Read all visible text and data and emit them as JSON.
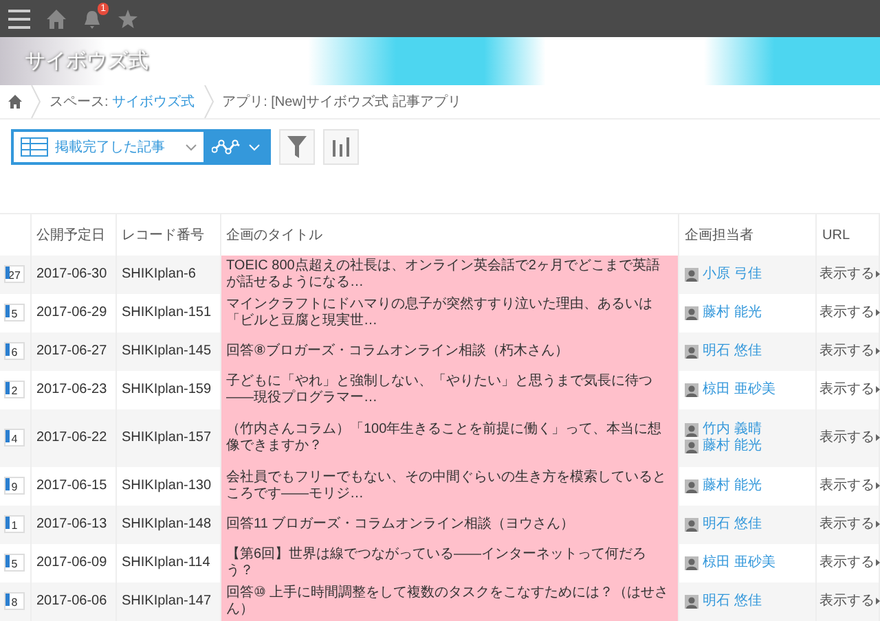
{
  "topbar": {
    "notification_badge": "1"
  },
  "banner": {
    "title": "サイボウズ式"
  },
  "breadcrumb": [
    {
      "prefix": "スペース: ",
      "link": "サイボウズ式"
    },
    {
      "prefix": "アプリ: [New]サイボウズ式 記事アプリ"
    }
  ],
  "view_select": {
    "value": "掲載完了した記事"
  },
  "table": {
    "columns": [
      "公開予定日",
      "レコード番号",
      "企画のタイトル",
      "企画担当者",
      "URL"
    ],
    "rows": [
      {
        "day": "27",
        "date": "2017-06-30",
        "record": "SHIKIplan-6",
        "title": "TOEIC 800点超えの社長は、オンライン英会話で2ヶ月でどこまで英語が話せるようになる…",
        "people": [
          "小原 弓佳"
        ],
        "url": "表示する"
      },
      {
        "day": "5",
        "date": "2017-06-29",
        "record": "SHIKIplan-151",
        "title": "マインクラフトにドハマりの息子が突然すすり泣いた理由、あるいは「ビルと豆腐と現実世…",
        "people": [
          "藤村 能光"
        ],
        "url": "表示する"
      },
      {
        "day": "6",
        "date": "2017-06-27",
        "record": "SHIKIplan-145",
        "title": "回答⑧ブロガーズ・コラムオンライン相談（朽木さん）",
        "people": [
          "明石 悠佳"
        ],
        "url": "表示する"
      },
      {
        "day": "2",
        "date": "2017-06-23",
        "record": "SHIKIplan-159",
        "title": "子どもに「やれ」と強制しない、「やりたい」と思うまで気長に待つ――現役プログラマー…",
        "people": [
          "椋田 亜砂美"
        ],
        "url": "表示する"
      },
      {
        "day": "4",
        "date": "2017-06-22",
        "record": "SHIKIplan-157",
        "title": "（竹内さんコラム）「100年生きることを前提に働く」って、本当に想像できますか？",
        "people": [
          "竹内 義晴",
          "藤村 能光"
        ],
        "url": "表示する"
      },
      {
        "day": "9",
        "date": "2017-06-15",
        "record": "SHIKIplan-130",
        "title": "会社員でもフリーでもない、その中間ぐらいの生き方を模索しているところです――モリジ…",
        "people": [
          "藤村 能光"
        ],
        "url": "表示する"
      },
      {
        "day": "1",
        "date": "2017-06-13",
        "record": "SHIKIplan-148",
        "title": "回答11 ブロガーズ・コラムオンライン相談（ヨウさん）",
        "people": [
          "明石 悠佳"
        ],
        "url": "表示する"
      },
      {
        "day": "5",
        "date": "2017-06-09",
        "record": "SHIKIplan-114",
        "title": "【第6回】世界は線でつながっている――インターネットって何だろう？",
        "people": [
          "椋田 亜砂美"
        ],
        "url": "表示する"
      },
      {
        "day": "8",
        "date": "2017-06-06",
        "record": "SHIKIplan-147",
        "title": "回答⑩ 上手に時間調整をして複数のタスクをこなすためには？（はせさん）",
        "people": [
          "明石 悠佳"
        ],
        "url": "表示する"
      }
    ]
  }
}
